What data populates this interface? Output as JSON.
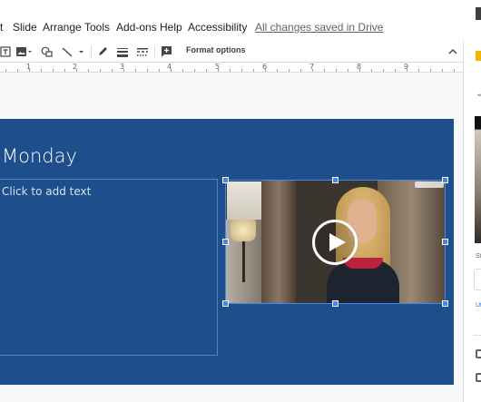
{
  "menubar": {
    "items": [
      "t",
      "Slide",
      "Arrange",
      "Tools",
      "Add-ons",
      "Help",
      "Accessibility"
    ],
    "saved_status": "All changes saved in Drive"
  },
  "toolbar": {
    "format_options_label": "Format options",
    "icons": [
      "text-box-icon",
      "image-icon",
      "shape-icon",
      "line-icon",
      "pen-icon",
      "border-weight-icon",
      "border-dash-icon",
      "add-comment-icon",
      "collapse-icon"
    ]
  },
  "ruler": {
    "numbers": [
      "1",
      "2",
      "3",
      "4",
      "5",
      "6",
      "7",
      "8",
      "9"
    ]
  },
  "slide": {
    "title": "Monday",
    "body_placeholder": "Click to add text",
    "background_color": "#1e4e8c"
  },
  "side_panel": {
    "label_partial": "St",
    "link_partial": "Ur"
  },
  "colors": {
    "selection": "#4a86e8",
    "accent": "#1a73e8"
  }
}
